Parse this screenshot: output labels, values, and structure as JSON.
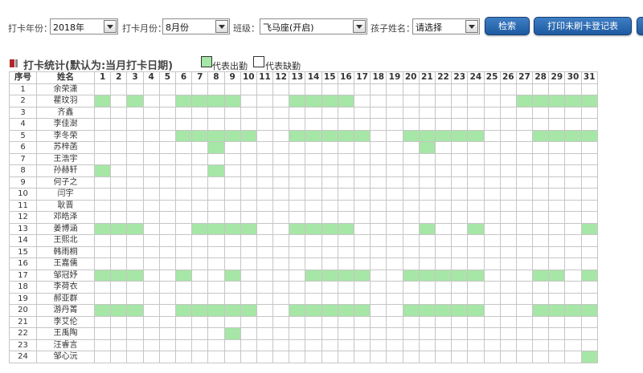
{
  "toolbar": {
    "year_label": "打卡年份：",
    "year_value": "2018年",
    "month_label": "打卡月份：",
    "month_value": "8月份",
    "class_label": "班级：",
    "class_value": "飞马座(开启)",
    "child_label": "孩子姓名：",
    "child_value": "请选择",
    "search_label": "检索",
    "print_label": "打印未刷卡登记表"
  },
  "title": "打卡统计(默认为:当月打卡日期)",
  "legend": {
    "present_label": "代表出勤",
    "absent_label": "代表缺勤"
  },
  "colors": {
    "present": "#a6e6a6",
    "button": "#2a67b0",
    "title_mark": "#b0282c"
  },
  "table": {
    "headers": {
      "index": "序号",
      "name": "姓名",
      "days": [
        "1",
        "2",
        "3",
        "4",
        "5",
        "6",
        "7",
        "8",
        "9",
        "10",
        "11",
        "12",
        "13",
        "14",
        "15",
        "16",
        "17",
        "18",
        "19",
        "20",
        "21",
        "22",
        "23",
        "24",
        "25",
        "26",
        "27",
        "28",
        "29",
        "30",
        "31"
      ]
    },
    "rows": [
      {
        "index": "1",
        "name": "余荣潇",
        "present": []
      },
      {
        "index": "2",
        "name": "瞿玟羽",
        "present": [
          1,
          3,
          6,
          7,
          8,
          9,
          13,
          14,
          15,
          16,
          27,
          28,
          29,
          30,
          31
        ]
      },
      {
        "index": "3",
        "name": "齐鑫",
        "present": []
      },
      {
        "index": "4",
        "name": "李佳澍",
        "present": []
      },
      {
        "index": "5",
        "name": "李冬荣",
        "present": [
          6,
          7,
          8,
          9,
          10,
          13,
          14,
          15,
          16,
          17,
          20,
          21,
          22,
          23,
          24,
          28,
          29,
          30,
          31
        ]
      },
      {
        "index": "6",
        "name": "苏梓菡",
        "present": [
          8,
          21
        ]
      },
      {
        "index": "7",
        "name": "王浩宇",
        "present": []
      },
      {
        "index": "8",
        "name": "孙赫轩",
        "present": [
          1,
          8
        ]
      },
      {
        "index": "9",
        "name": "何子之",
        "present": []
      },
      {
        "index": "10",
        "name": "闫宇",
        "present": []
      },
      {
        "index": "11",
        "name": "耿晋",
        "present": []
      },
      {
        "index": "12",
        "name": "邓皓泽",
        "present": []
      },
      {
        "index": "13",
        "name": "姜博涵",
        "present": [
          1,
          2,
          3,
          7,
          8,
          9,
          10,
          13,
          14,
          15,
          16,
          21,
          24,
          31
        ]
      },
      {
        "index": "14",
        "name": "王熙北",
        "present": []
      },
      {
        "index": "15",
        "name": "韩雨桐",
        "present": []
      },
      {
        "index": "16",
        "name": "王嘉儒",
        "present": []
      },
      {
        "index": "17",
        "name": "邹冠妤",
        "present": [
          1,
          2,
          3,
          6,
          9,
          14,
          15,
          16,
          17,
          20,
          21,
          22,
          23,
          24,
          28,
          29,
          31
        ]
      },
      {
        "index": "18",
        "name": "李荷衣",
        "present": []
      },
      {
        "index": "19",
        "name": "郝亚群",
        "present": []
      },
      {
        "index": "20",
        "name": "游丹菁",
        "present": [
          1,
          2,
          3,
          6,
          7,
          8,
          9,
          10,
          13,
          14,
          15,
          16,
          17,
          20,
          21,
          22,
          23,
          24,
          28,
          29,
          30,
          31
        ]
      },
      {
        "index": "21",
        "name": "李艾伦",
        "present": []
      },
      {
        "index": "22",
        "name": "王禹陶",
        "present": [
          9
        ]
      },
      {
        "index": "23",
        "name": "汪睿言",
        "present": []
      },
      {
        "index": "24",
        "name": "邹心沅",
        "present": [
          31
        ]
      }
    ]
  }
}
